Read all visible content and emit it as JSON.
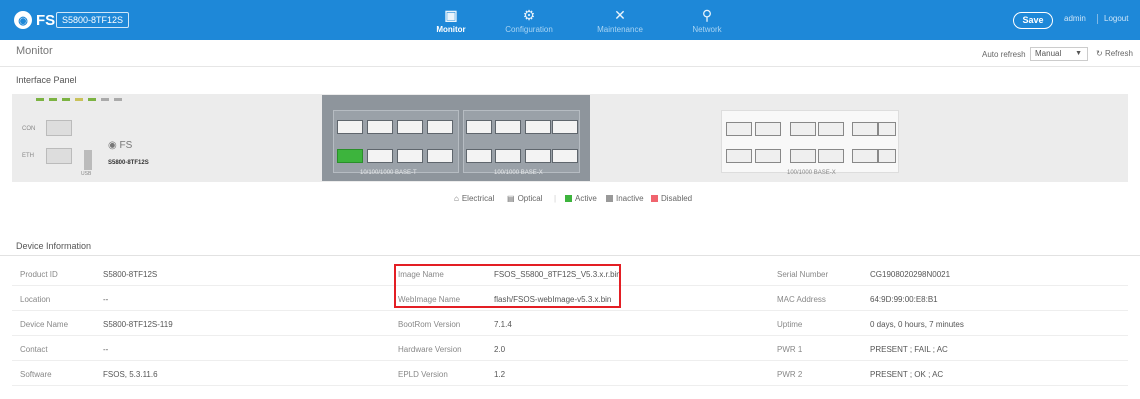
{
  "header": {
    "brand": "FS",
    "model": "S5800-8TF12S",
    "nav": [
      {
        "label": "Monitor",
        "icon": "monitor-icon",
        "active": true
      },
      {
        "label": "Configuration",
        "icon": "gear-icon",
        "active": false
      },
      {
        "label": "Maintenance",
        "icon": "tools-icon",
        "active": false
      },
      {
        "label": "Network",
        "icon": "network-icon",
        "active": false
      }
    ],
    "save_label": "Save",
    "user": "admin",
    "logout": "Logout"
  },
  "page": {
    "title": "Monitor",
    "auto_refresh_label": "Auto refresh",
    "auto_refresh_value": "Manual",
    "refresh_label": "Refresh"
  },
  "interface_panel": {
    "title": "Interface Panel",
    "con_label": "CON",
    "eth_label": "ETH",
    "usb_label": "USB",
    "device_model": "S5800-8TF12S",
    "fs_logo": "FS",
    "group1_label": "10/100/1000 BASE-T",
    "group2_label": "100/1000 BASE-X",
    "group3_label": "100/1000 BASE-X",
    "legend": [
      {
        "label": "Electrical",
        "icon": "electrical-port-icon",
        "color": "#666666"
      },
      {
        "label": "Optical",
        "icon": "optical-port-icon",
        "color": "#666666"
      },
      {
        "label": "Active",
        "color": "#3db43d"
      },
      {
        "label": "Inactive",
        "color": "#999999"
      },
      {
        "label": "Disabled",
        "color": "#f0646e"
      }
    ]
  },
  "device_info": {
    "title": "Device Information",
    "col1": [
      {
        "label": "Product ID",
        "value": "S5800-8TF12S"
      },
      {
        "label": "Location",
        "value": "--"
      },
      {
        "label": "Device Name",
        "value": "S5800-8TF12S-119"
      },
      {
        "label": "Contact",
        "value": "--"
      },
      {
        "label": "Software",
        "value": "FSOS, 5.3.11.6"
      }
    ],
    "col2": [
      {
        "label": "Image Name",
        "value": "FSOS_S5800_8TF12S_V5.3.x.r.bin"
      },
      {
        "label": "WebImage Name",
        "value": "flash/FSOS-webImage-v5.3.x.bin"
      },
      {
        "label": "BootRom Version",
        "value": "7.1.4"
      },
      {
        "label": "Hardware Version",
        "value": "2.0"
      },
      {
        "label": "EPLD Version",
        "value": "1.2"
      }
    ],
    "col3": [
      {
        "label": "Serial Number",
        "value": "CG1908020298N0021"
      },
      {
        "label": "MAC Address",
        "value": "64:9D:99:00:E8:B1"
      },
      {
        "label": "Uptime",
        "value": "0 days, 0 hours, 7 minutes"
      },
      {
        "label": "PWR 1",
        "value": "PRESENT ; FAIL ; AC"
      },
      {
        "label": "PWR 2",
        "value": "PRESENT ; OK ; AC"
      }
    ]
  },
  "colors": {
    "header": "#1e88d8",
    "highlight": "#e31e24"
  }
}
